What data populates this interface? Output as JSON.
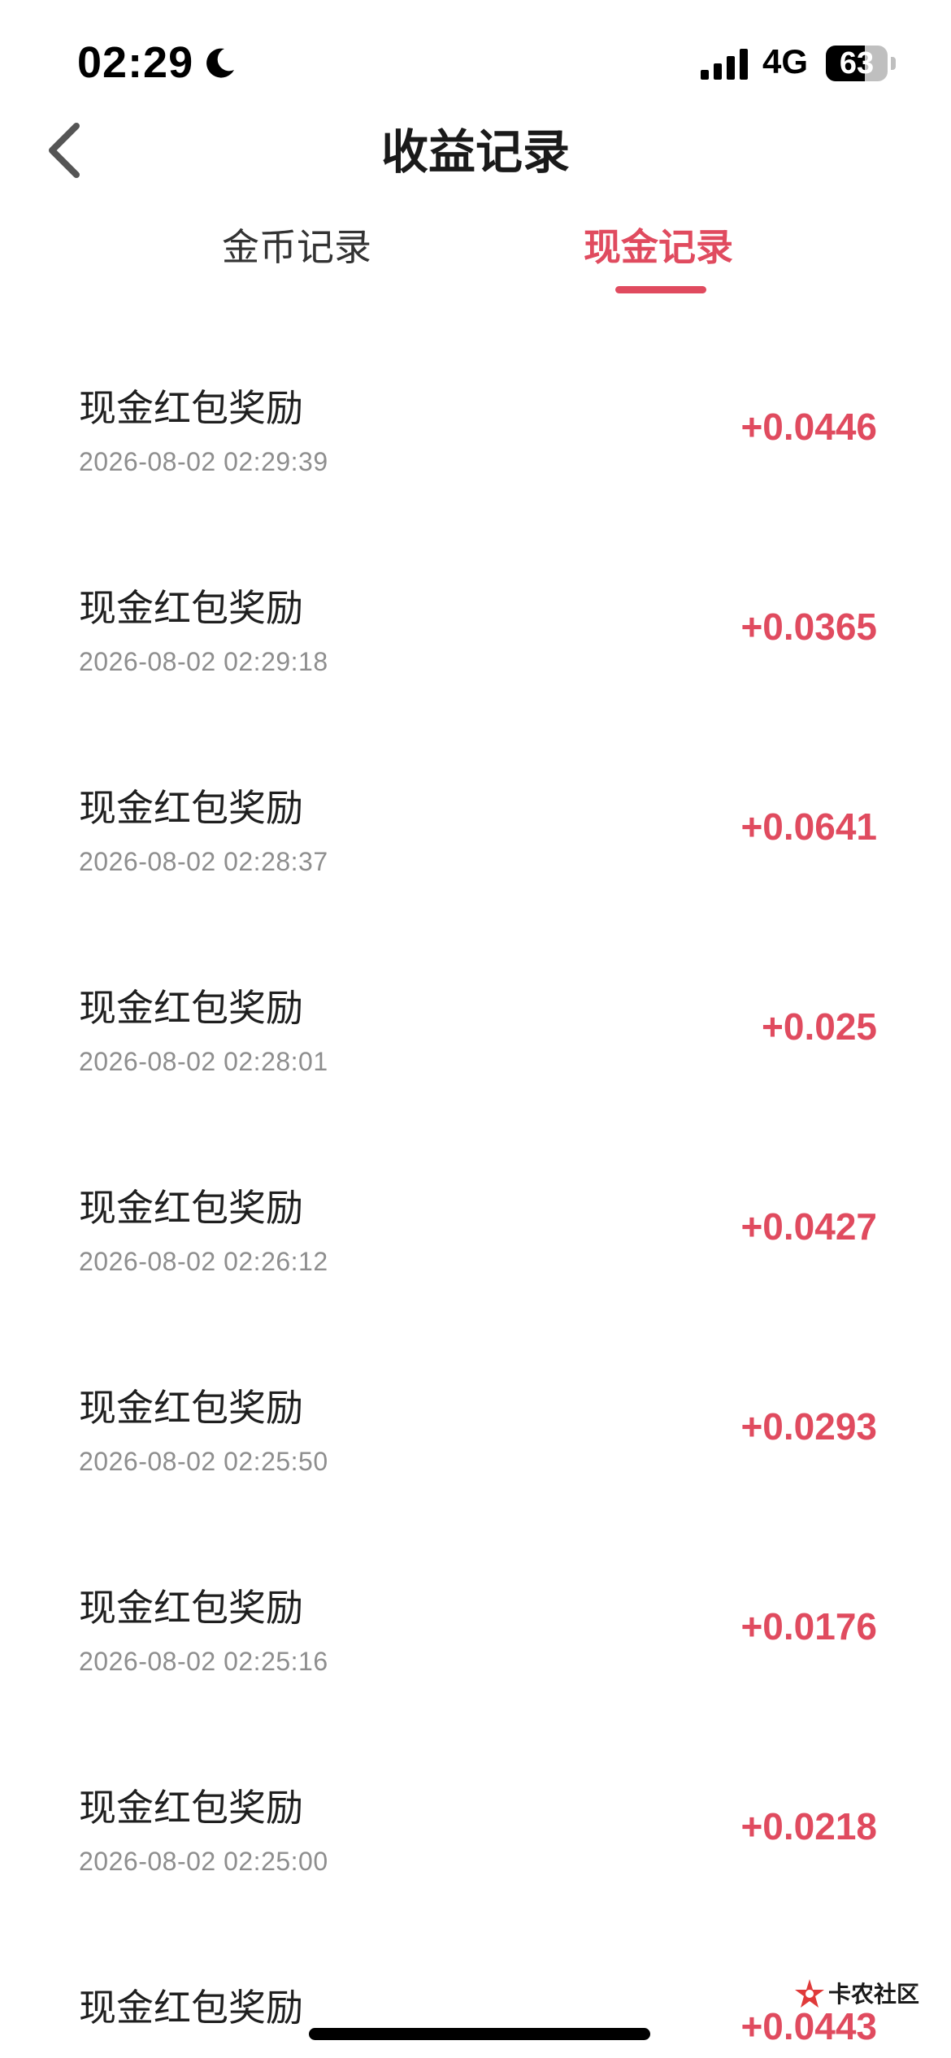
{
  "status_bar": {
    "time": "02:29",
    "network": "4G",
    "battery_level": "63",
    "battery_fraction": 0.63
  },
  "header": {
    "title": "收益记录"
  },
  "tabs": [
    {
      "label": "金币记录",
      "active": false
    },
    {
      "label": "现金记录",
      "active": true
    }
  ],
  "records": [
    {
      "title": "现金红包奖励",
      "time": "2026-08-02 02:29:39",
      "amount": "+0.0446"
    },
    {
      "title": "现金红包奖励",
      "time": "2026-08-02 02:29:18",
      "amount": "+0.0365"
    },
    {
      "title": "现金红包奖励",
      "time": "2026-08-02 02:28:37",
      "amount": "+0.0641"
    },
    {
      "title": "现金红包奖励",
      "time": "2026-08-02 02:28:01",
      "amount": "+0.025"
    },
    {
      "title": "现金红包奖励",
      "time": "2026-08-02 02:26:12",
      "amount": "+0.0427"
    },
    {
      "title": "现金红包奖励",
      "time": "2026-08-02 02:25:50",
      "amount": "+0.0293"
    },
    {
      "title": "现金红包奖励",
      "time": "2026-08-02 02:25:16",
      "amount": "+0.0176"
    },
    {
      "title": "现金红包奖励",
      "time": "2026-08-02 02:25:00",
      "amount": "+0.0218"
    },
    {
      "title": "现金红包奖励",
      "time": "",
      "amount": "+0.0443"
    }
  ],
  "watermark": {
    "text": "卡农社区"
  },
  "colors": {
    "accent": "#e04b5f",
    "text_primary": "#1f1f1f",
    "text_secondary": "#8e8e8e"
  },
  "icons": {
    "back": "chevron-left-icon",
    "moon": "moon-icon",
    "signal": "signal-bars-icon",
    "battery": "battery-icon"
  }
}
